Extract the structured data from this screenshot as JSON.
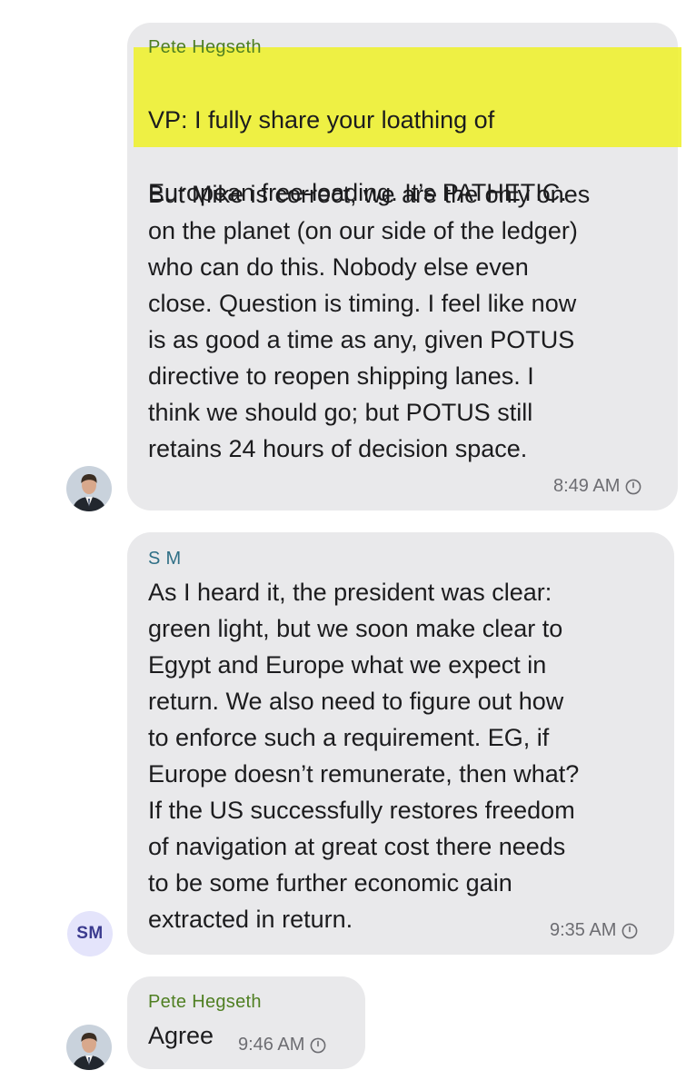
{
  "messages": [
    {
      "sender": "Pete Hegseth",
      "highlighted_lines": [
        "VP: I fully share your loathing of",
        "European free-loading. It’s PATHETIC."
      ],
      "body": "But Mike is correct, we are the only ones\non the planet (on our side of the ledger)\nwho can do this. Nobody else even\nclose. Question is timing. I feel like now\nis as good a time as any, given POTUS\ndirective to reopen shipping lanes. I\nthink we should go; but POTUS still\nretains 24 hours of decision space.",
      "time": "8:49 AM",
      "avatar": "photo",
      "status_icon": "clock-icon"
    },
    {
      "sender": "S M",
      "body": "As I heard it, the president was clear:\ngreen light, but we soon make clear to\nEgypt and Europe what we expect in\nreturn. We also need to figure out how\nto enforce such a requirement. EG, if\nEurope doesn’t remunerate, then what?\nIf the US successfully restores freedom\nof navigation at great cost there needs\nto be some further economic gain\nextracted in return.",
      "time": "9:35 AM",
      "avatar_initials": "SM",
      "status_icon": "clock-icon"
    },
    {
      "sender": "Pete Hegseth",
      "body": "Agree",
      "time": "9:46 AM",
      "avatar": "photo",
      "status_icon": "clock-icon"
    }
  ],
  "colors": {
    "bubble": "#e9e9eb",
    "highlight": "#eef02c",
    "sender_green": "#4f7f22",
    "sender_teal": "#2f6f86",
    "timestamp": "#6d6d72",
    "initials_avatar_bg": "#e4e4fb"
  }
}
